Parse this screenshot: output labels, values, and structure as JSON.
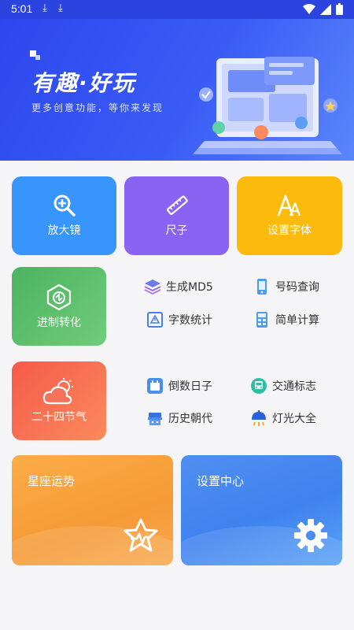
{
  "status_bar": {
    "time": "5:01"
  },
  "banner": {
    "title": "有趣·好玩",
    "subtitle": "更多创意功能，等你来发现"
  },
  "tiles": {
    "magnifier": "放大镜",
    "ruler": "尺子",
    "font": "设置字体",
    "base": "进制转化",
    "solar_terms": "二十四节气"
  },
  "menu": {
    "md5": "生成MD5",
    "phone": "号码查询",
    "wordcount": "字数统计",
    "calc": "简单计算",
    "countdown": "倒数日子",
    "traffic": "交通标志",
    "history": "历史朝代",
    "lights": "灯光大全"
  },
  "cards": {
    "horoscope": "星座运势",
    "settings": "设置中心"
  },
  "colors": {
    "banner": "#2d47ef",
    "magnifier": "#3795fb",
    "ruler": "#8a63f3",
    "font": "#fcbb0c",
    "base": "#4cb360",
    "solar": "#f55a4a",
    "horoscope": "#f8a43e",
    "settings": "#4a8cf0"
  }
}
